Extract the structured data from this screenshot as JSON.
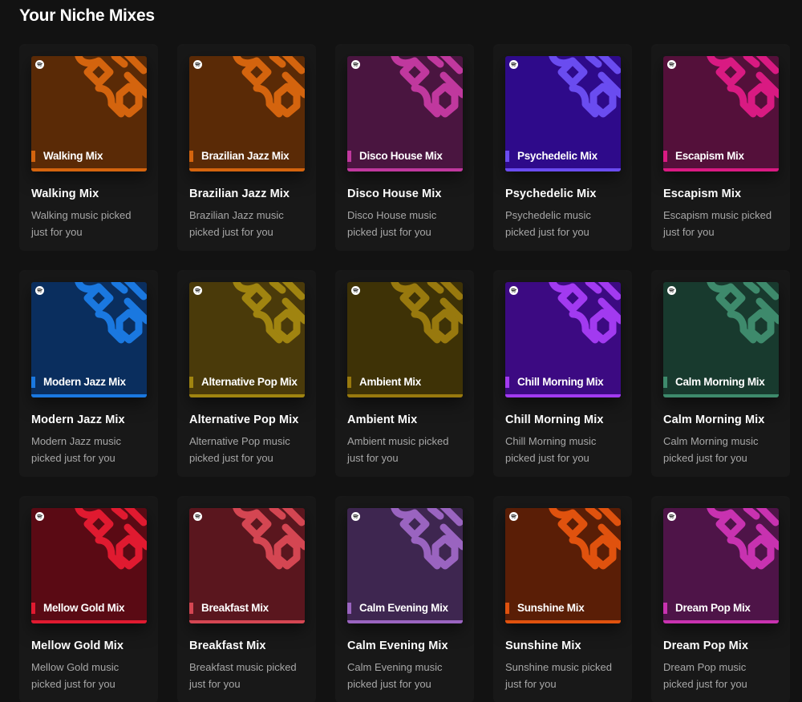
{
  "section": {
    "title": "Your Niche Mixes"
  },
  "cards": [
    {
      "title": "Walking Mix",
      "cover_label": "Walking Mix",
      "description": "Walking music picked just for you",
      "bg": "#5a2a06",
      "accent": "#d4640e"
    },
    {
      "title": "Brazilian Jazz Mix",
      "cover_label": "Brazilian Jazz Mix",
      "description": "Brazilian Jazz music picked just for you",
      "bg": "#5a2a06",
      "accent": "#d4640e"
    },
    {
      "title": "Disco House Mix",
      "cover_label": "Disco House Mix",
      "description": "Disco House music picked just for you",
      "bg": "#4a1540",
      "accent": "#c0389e"
    },
    {
      "title": "Psychedelic Mix",
      "cover_label": "Psychedelic Mix",
      "description": "Psychedelic music picked just for you",
      "bg": "#2e0a8a",
      "accent": "#6a4cf0"
    },
    {
      "title": "Escapism Mix",
      "cover_label": "Escapism Mix",
      "description": "Escapism music picked just for you",
      "bg": "#54103a",
      "accent": "#d91a82"
    },
    {
      "title": "Modern Jazz Mix",
      "cover_label": "Modern Jazz Mix",
      "description": "Modern Jazz music picked just for you",
      "bg": "#0a2e5e",
      "accent": "#1a78e0"
    },
    {
      "title": "Alternative Pop Mix",
      "cover_label": "Alternative Pop Mix",
      "description": "Alternative Pop music picked just for you",
      "bg": "#4a3a0a",
      "accent": "#a08410"
    },
    {
      "title": "Ambient Mix",
      "cover_label": "Ambient Mix",
      "description": "Ambient music picked just for you",
      "bg": "#3e3206",
      "accent": "#98790e"
    },
    {
      "title": "Chill Morning Mix",
      "cover_label": "Chill Morning Mix",
      "description": "Chill Morning music picked just for you",
      "bg": "#3c0a82",
      "accent": "#a23af0"
    },
    {
      "title": "Calm Morning Mix",
      "cover_label": "Calm Morning Mix",
      "description": "Calm Morning music picked just for you",
      "bg": "#183a2e",
      "accent": "#3e8a6c"
    },
    {
      "title": "Mellow Gold Mix",
      "cover_label": "Mellow Gold Mix",
      "description": "Mellow Gold music picked just for you",
      "bg": "#5a0a14",
      "accent": "#e01a30"
    },
    {
      "title": "Breakfast Mix",
      "cover_label": "Breakfast Mix",
      "description": "Breakfast music picked just for you",
      "bg": "#5a161e",
      "accent": "#d44652"
    },
    {
      "title": "Calm Evening Mix",
      "cover_label": "Calm Evening Mix",
      "description": "Calm Evening music picked just for you",
      "bg": "#3e2650",
      "accent": "#9a64c0"
    },
    {
      "title": "Sunshine Mix",
      "cover_label": "Sunshine Mix",
      "description": "Sunshine music picked just for you",
      "bg": "#5a1e06",
      "accent": "#e0520e"
    },
    {
      "title": "Dream Pop Mix",
      "cover_label": "Dream Pop Mix",
      "description": "Dream Pop music picked just for you",
      "bg": "#4e1448",
      "accent": "#c832b0"
    }
  ]
}
